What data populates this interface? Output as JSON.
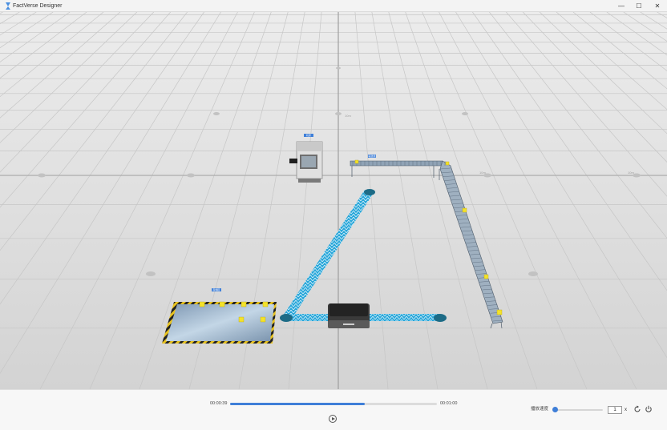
{
  "window": {
    "title": "FactVerse Designer",
    "minimize": "—",
    "maximize": "☐",
    "close": "✕"
  },
  "scene": {
    "tags": {
      "machine": "机床",
      "conveyor": "输送线",
      "storage": "存储区"
    },
    "grid_labels": [
      "10m",
      "10m",
      "10m"
    ]
  },
  "playback": {
    "current_time": "00:00:39",
    "total_time": "00:01:00",
    "progress": 0.65,
    "speed_label": "播放速度",
    "speed_value": "1",
    "speed_unit": "x",
    "speed_level": 0.0
  },
  "colors": {
    "accent": "#3f7fd8",
    "track_blue": "#2aa7d9",
    "node": "#1d6b86",
    "item": "#f3e22a"
  }
}
